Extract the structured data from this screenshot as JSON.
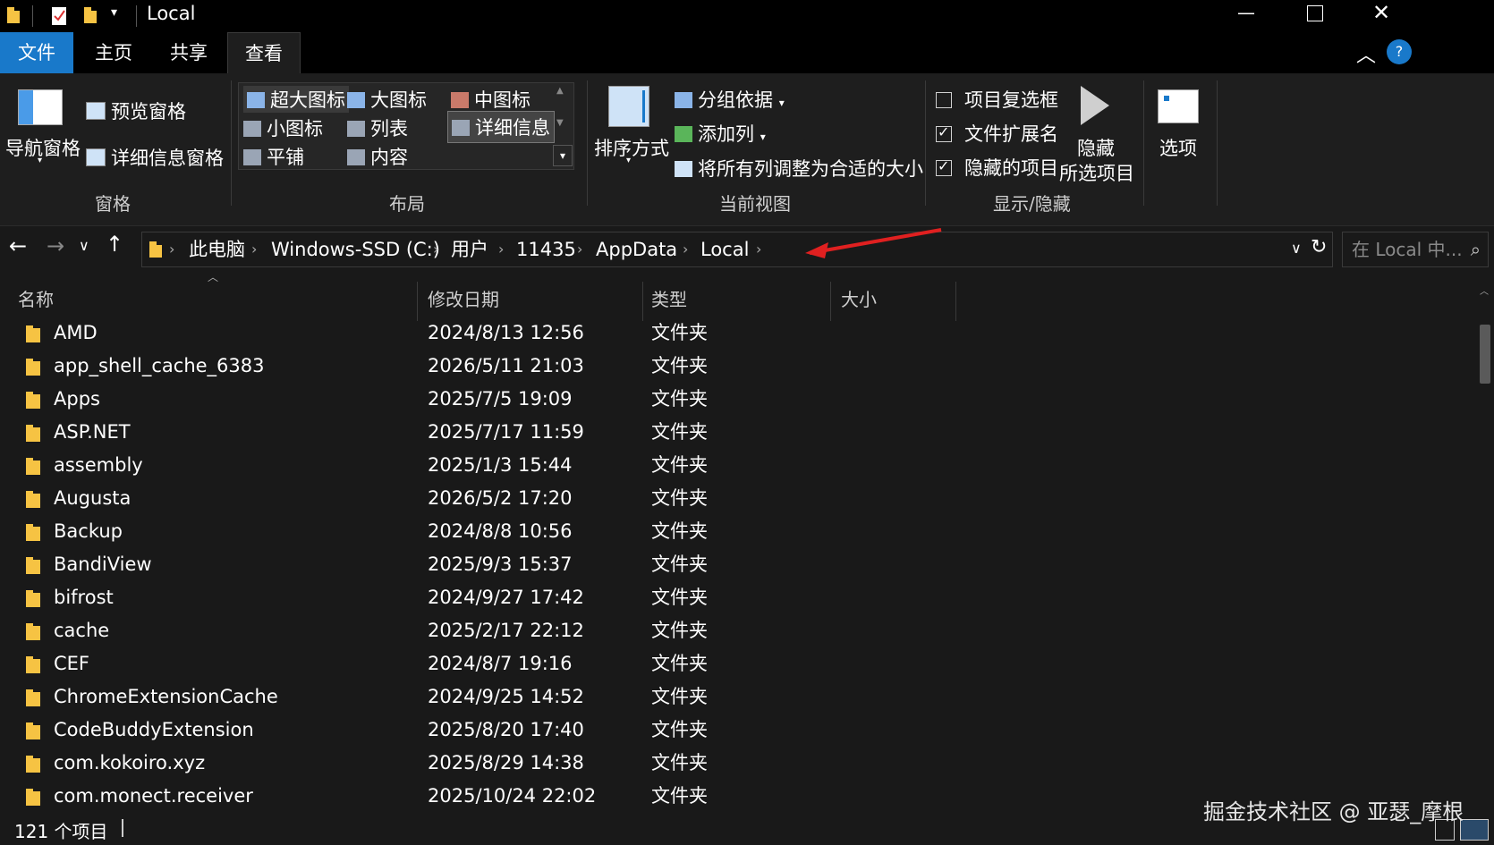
{
  "window": {
    "title": "Local"
  },
  "menu_tabs": [
    "文件",
    "主页",
    "共享",
    "查看"
  ],
  "ribbon": {
    "panes": {
      "nav_pane": "导航窗格",
      "preview_pane": "预览窗格",
      "details_pane": "详细信息窗格",
      "group_label": "窗格"
    },
    "layout": {
      "items": [
        "超大图标",
        "大图标",
        "中图标",
        "小图标",
        "列表",
        "详细信息",
        "平铺",
        "内容"
      ],
      "group_label": "布局"
    },
    "current_view": {
      "sort_by": "排序方式",
      "group_by": "分组依据",
      "add_column": "添加列",
      "fit_columns": "将所有列调整为合适的大小",
      "group_label": "当前视图"
    },
    "show_hide": {
      "item_checkboxes": "项目复选框",
      "file_extensions": "文件扩展名",
      "hidden_items": "隐藏的项目",
      "hide_selected_1": "隐藏",
      "hide_selected_2": "所选项目",
      "group_label": "显示/隐藏"
    },
    "options": "选项"
  },
  "checkbox_states": {
    "item_checkboxes": false,
    "file_extensions": true,
    "hidden_items": true
  },
  "breadcrumb": [
    "此电脑",
    "Windows-SSD (C:)",
    "用户",
    "11435",
    "AppData",
    "Local"
  ],
  "search": {
    "placeholder": "在 Local 中..."
  },
  "columns": [
    "名称",
    "修改日期",
    "类型",
    "大小"
  ],
  "files": [
    {
      "name": "AMD",
      "date": "2024/8/13 12:56",
      "type": "文件夹"
    },
    {
      "name": "app_shell_cache_6383",
      "date": "2026/5/11 21:03",
      "type": "文件夹"
    },
    {
      "name": "Apps",
      "date": "2025/7/5 19:09",
      "type": "文件夹"
    },
    {
      "name": "ASP.NET",
      "date": "2025/7/17 11:59",
      "type": "文件夹"
    },
    {
      "name": "assembly",
      "date": "2025/1/3 15:44",
      "type": "文件夹"
    },
    {
      "name": "Augusta",
      "date": "2026/5/2 17:20",
      "type": "文件夹"
    },
    {
      "name": "Backup",
      "date": "2024/8/8 10:56",
      "type": "文件夹"
    },
    {
      "name": "BandiView",
      "date": "2025/9/3 15:37",
      "type": "文件夹"
    },
    {
      "name": "bifrost",
      "date": "2024/9/27 17:42",
      "type": "文件夹"
    },
    {
      "name": "cache",
      "date": "2025/2/17 22:12",
      "type": "文件夹"
    },
    {
      "name": "CEF",
      "date": "2024/8/7 19:16",
      "type": "文件夹"
    },
    {
      "name": "ChromeExtensionCache",
      "date": "2024/9/25 14:52",
      "type": "文件夹"
    },
    {
      "name": "CodeBuddyExtension",
      "date": "2025/8/20 17:40",
      "type": "文件夹"
    },
    {
      "name": "com.kokoiro.xyz",
      "date": "2025/8/29 14:38",
      "type": "文件夹"
    },
    {
      "name": "com.monect.receiver",
      "date": "2025/10/24 22:02",
      "type": "文件夹"
    }
  ],
  "status": {
    "item_count": "121 个项目"
  },
  "watermark": "掘金技术社区 @ 亚瑟_摩根",
  "colors": {
    "accent": "#1979ca",
    "folder": "#f6c343",
    "annotation_arrow": "#e02020"
  }
}
